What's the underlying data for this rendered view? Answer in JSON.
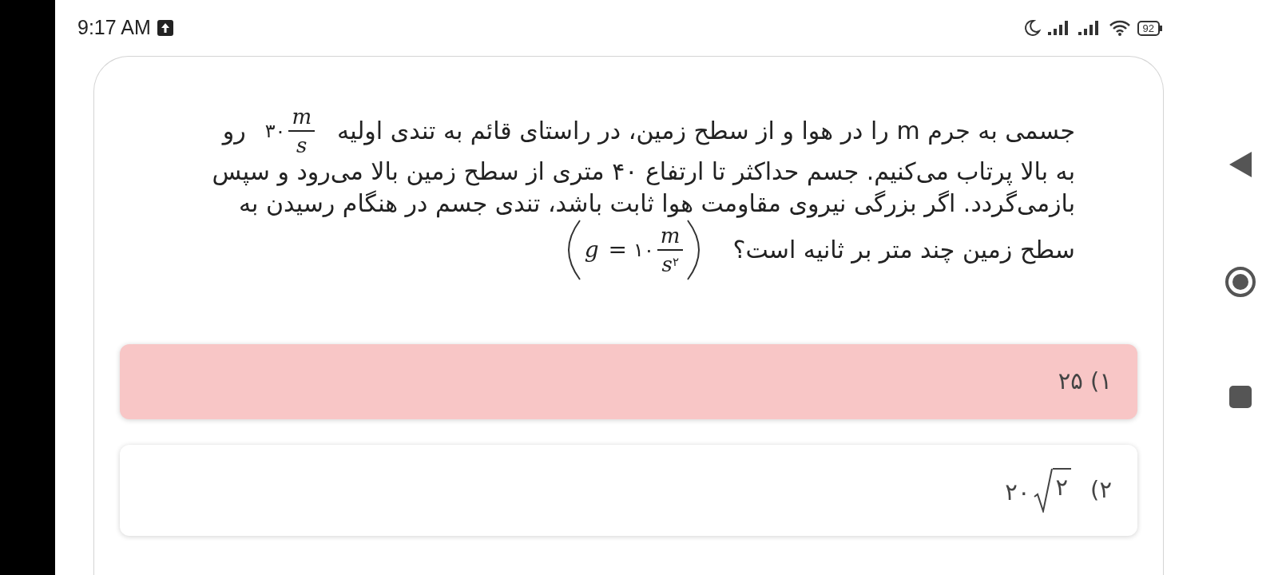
{
  "status_bar": {
    "time": "9:17 AM",
    "battery": "92"
  },
  "question": {
    "lines": [
      [
        {
          "kind": "text",
          "text": "جسمی به جرم m را در هوا و از سطح زمین، در راستای قائم به تندی اولیه"
        },
        {
          "kind": "frac",
          "coef": "۳۰",
          "num": "m",
          "den": "s"
        },
        {
          "kind": "text",
          "text": "رو"
        }
      ],
      [
        {
          "kind": "text",
          "text": "به بالا پرتاب می‌کنیم. جسم حداکثر تا ارتفاع ۴۰ متری از سطح زمین بالا می‌رود و سپس"
        }
      ],
      [
        {
          "kind": "text",
          "text": "بازمی‌گردد. اگر بزرگی نیروی مقاومت هوا ثابت باشد، تندی جسم در هنگام رسیدن به"
        }
      ],
      [
        {
          "kind": "text",
          "text": "سطح زمین چند متر بر ثانیه است؟"
        },
        {
          "kind": "paren_frac",
          "lhs": "g",
          "eq": "=",
          "coef": "۱۰",
          "num": "m",
          "den": "s",
          "sup": "۲"
        }
      ]
    ]
  },
  "options": [
    {
      "kind": "text",
      "label": "۱)",
      "text": "۲۵",
      "selected": true
    },
    {
      "kind": "sqrt",
      "label": "۲)",
      "coef": "۲۰",
      "radicand": "۲",
      "selected": false
    }
  ]
}
